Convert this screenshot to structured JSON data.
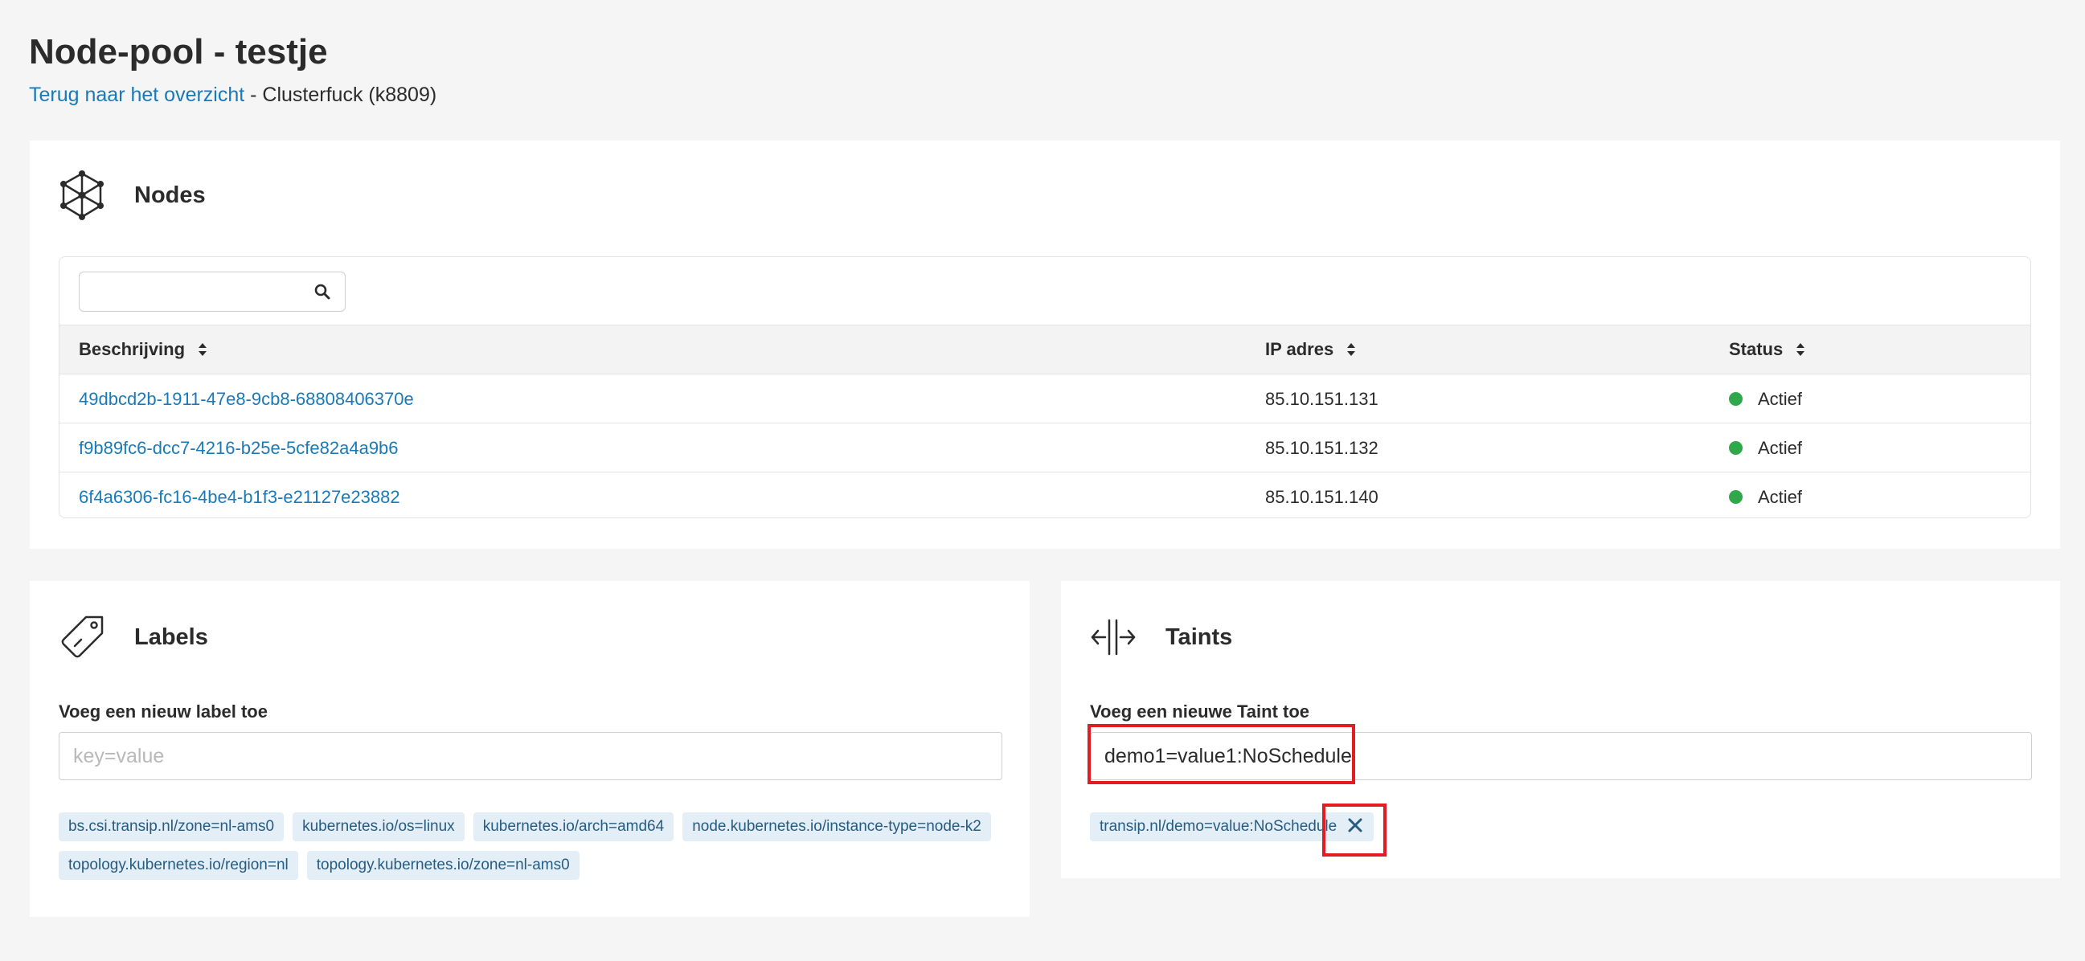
{
  "page": {
    "title": "Node-pool - testje",
    "back_link": "Terug naar het overzicht",
    "separator": " - ",
    "cluster": "Clusterfuck (k8809)"
  },
  "nodes": {
    "title": "Nodes",
    "icon": "cluster-icon",
    "search": {
      "value": "",
      "placeholder": ""
    },
    "columns": [
      "Beschrijving",
      "IP adres",
      "Status"
    ],
    "rows": [
      {
        "description": "49dbcd2b-1911-47e8-9cb8-68808406370e",
        "ip": "85.10.151.131",
        "status": "Actief"
      },
      {
        "description": "f9b89fc6-dcc7-4216-b25e-5cfe82a4a9b6",
        "ip": "85.10.151.132",
        "status": "Actief"
      },
      {
        "description": "6f4a6306-fc16-4be4-b1f3-e21127e23882",
        "ip": "85.10.151.140",
        "status": "Actief"
      }
    ],
    "status_color": "#2ea84a"
  },
  "labels": {
    "title": "Labels",
    "icon": "tag-icon",
    "field_label": "Voeg een nieuw label toe",
    "input": {
      "value": "",
      "placeholder": "key=value"
    },
    "tags": [
      "bs.csi.transip.nl/zone=nl-ams0",
      "kubernetes.io/os=linux",
      "kubernetes.io/arch=amd64",
      "node.kubernetes.io/instance-type=node-k2",
      "topology.kubernetes.io/region=nl",
      "topology.kubernetes.io/zone=nl-ams0"
    ]
  },
  "taints": {
    "title": "Taints",
    "icon": "split-arrows-icon",
    "field_label": "Voeg een nieuwe Taint toe",
    "input": {
      "value": "demo1=value1:NoSchedule",
      "placeholder": ""
    },
    "tags": [
      "transip.nl/demo=value:NoSchedule"
    ]
  },
  "colors": {
    "link": "#1a7ab8",
    "tag_bg": "#e3eef6",
    "tag_text": "#285b80",
    "highlight": "#e31b23"
  }
}
